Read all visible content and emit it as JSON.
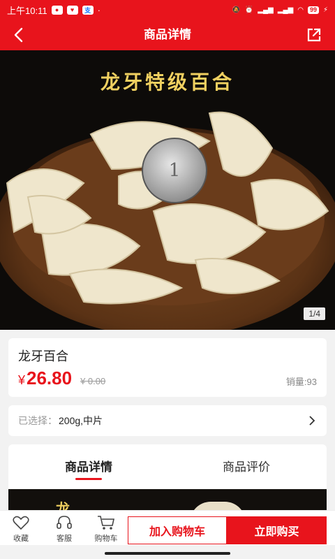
{
  "status_bar": {
    "time": "上午10:11",
    "app_icons": [
      "wechat-icon",
      "weibo-icon",
      "alipay-icon"
    ],
    "battery": "99",
    "network_labels": [
      "5G",
      "4G"
    ]
  },
  "header": {
    "title": "商品详情",
    "back_icon": "chevron-left-icon",
    "share_icon": "share-icon"
  },
  "gallery": {
    "banner_text": "龙牙特级百合",
    "counter": "1/4"
  },
  "product": {
    "name": "龙牙百合",
    "currency": "¥",
    "price": "26.80",
    "original_price": "¥ 0.00",
    "sales": "销量:93"
  },
  "selection": {
    "label": "已选择：",
    "value": "200g,中片"
  },
  "tabs": [
    {
      "label": "商品详情",
      "active": true
    },
    {
      "label": "商品评价",
      "active": false
    }
  ],
  "detail_image": {
    "glyph": "龙"
  },
  "bottom_bar": {
    "favorite_label": "收藏",
    "service_label": "客服",
    "cart_label": "购物车",
    "add_to_cart": "加入购物车",
    "buy_now": "立即购买"
  },
  "colors": {
    "brand_red": "#e8141c",
    "banner_gold": "#f0d060"
  }
}
